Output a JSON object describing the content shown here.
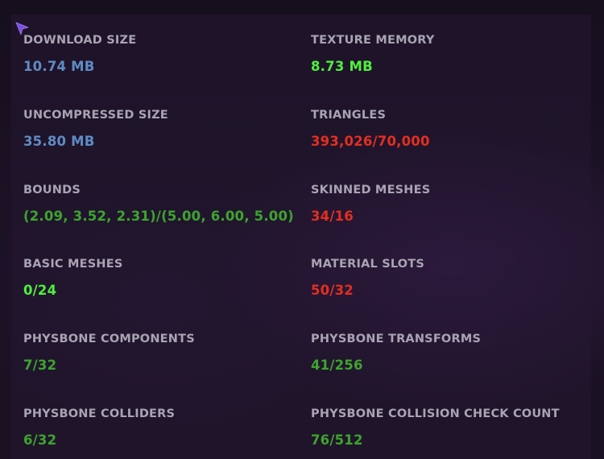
{
  "colors": {
    "blue": "#5f8bc4",
    "bright_green": "#4ef03c",
    "red": "#e22f1f",
    "green": "#3ca52c",
    "label": "#a8a4b2"
  },
  "stats": {
    "download_size": {
      "label": "DOWNLOAD SIZE",
      "value": "10.74 MB"
    },
    "texture_memory": {
      "label": "TEXTURE MEMORY",
      "value": "8.73 MB"
    },
    "uncompressed_size": {
      "label": "UNCOMPRESSED SIZE",
      "value": "35.80 MB"
    },
    "triangles": {
      "label": "TRIANGLES",
      "value": "393,026/70,000"
    },
    "bounds": {
      "label": "BOUNDS",
      "value": "(2.09, 3.52, 2.31)/(5.00, 6.00, 5.00)"
    },
    "skinned_meshes": {
      "label": "SKINNED MESHES",
      "value": "34/16"
    },
    "basic_meshes": {
      "label": "BASIC MESHES",
      "value": "0/24"
    },
    "material_slots": {
      "label": "MATERIAL SLOTS",
      "value": "50/32"
    },
    "physbone_components": {
      "label": "PHYSBONE COMPONENTS",
      "value": "7/32"
    },
    "physbone_transforms": {
      "label": "PHYSBONE TRANSFORMS",
      "value": "41/256"
    },
    "physbone_colliders": {
      "label": "PHYSBONE COLLIDERS",
      "value": "6/32"
    },
    "physbone_collision_check_count": {
      "label": "PHYSBONE COLLISION CHECK COUNT",
      "value": "76/512"
    }
  }
}
